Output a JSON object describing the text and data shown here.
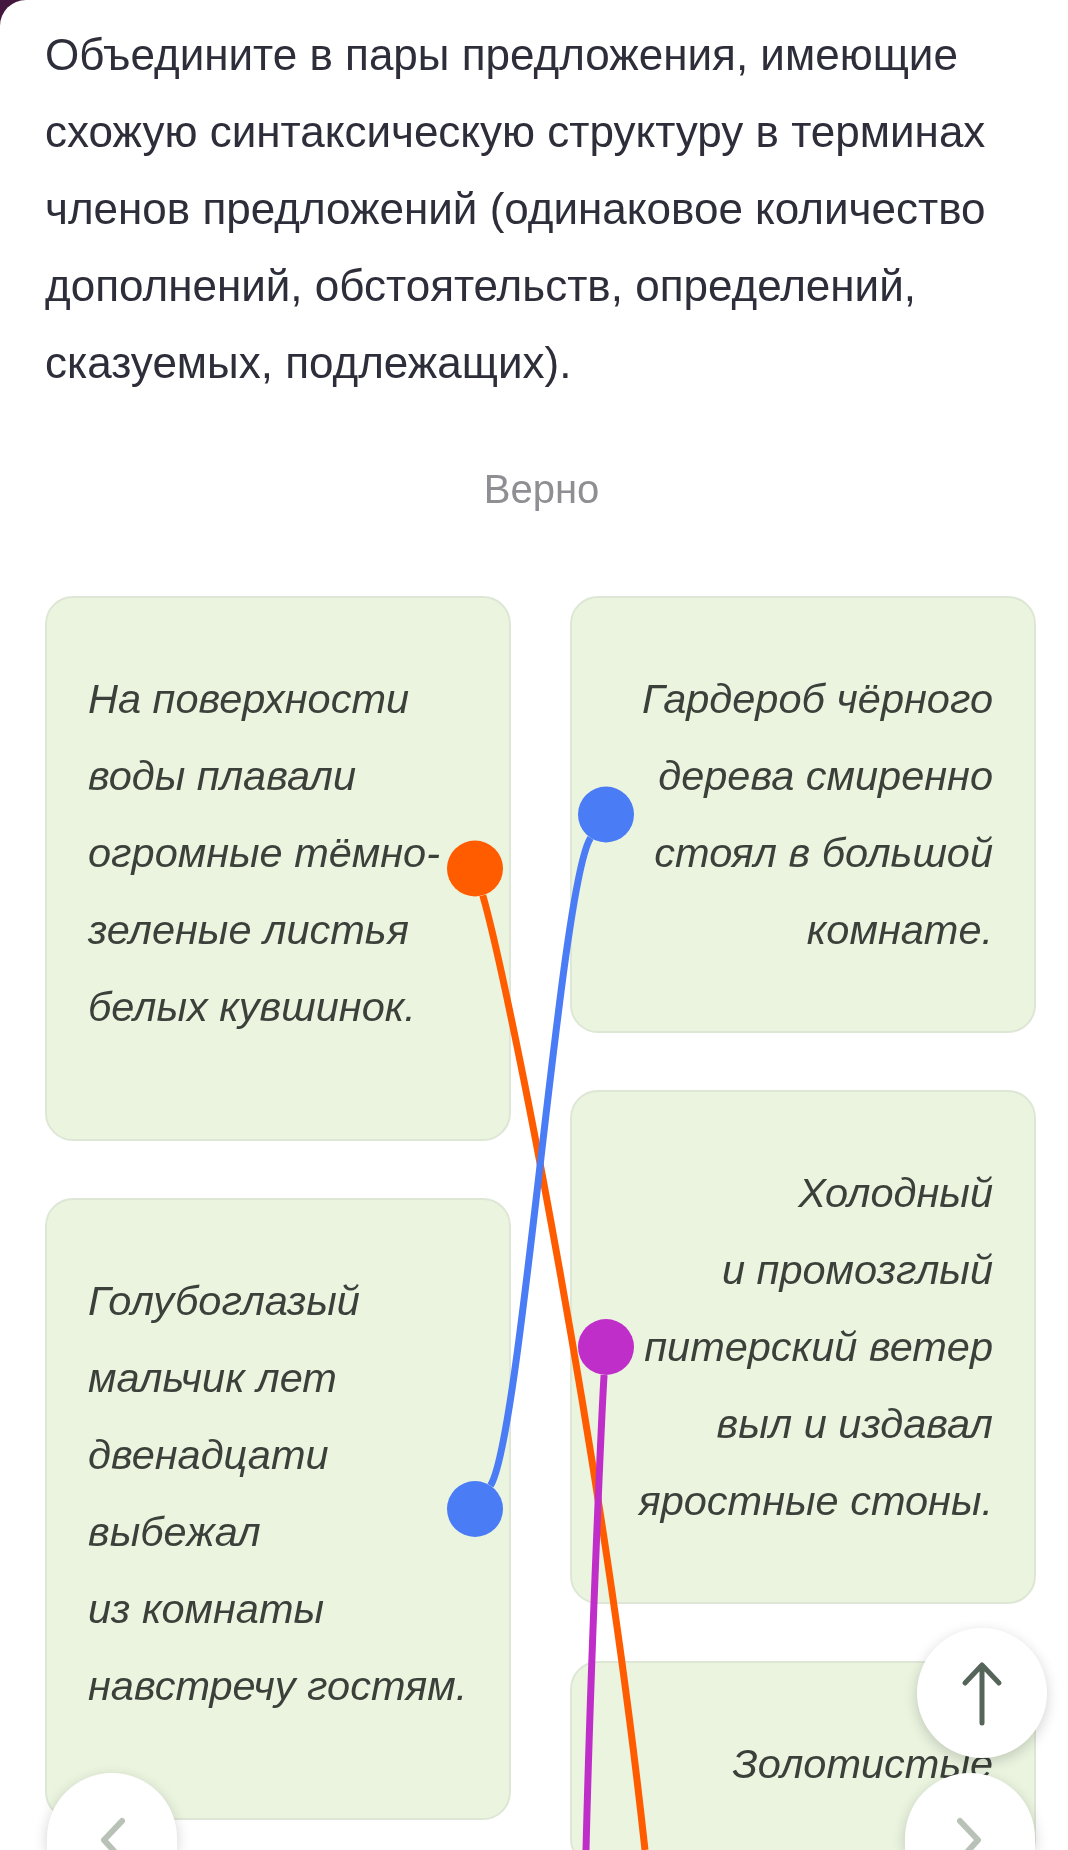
{
  "instruction": "Объедините в пары предложения, имеющие схожую синтаксическую структуру в терминах членов предложений (одинаковое количество дополнений, обстоятельств, определений, сказуемых, подлежащих).",
  "result": "Верно",
  "columns": [
    {
      "cards": [
        {
          "text": "На поверхности воды плавали огромные тёмно-зеленые листья белых кувшинок.",
          "handle": {
            "color": "#ff5c00"
          }
        },
        {
          "text": "Голубоглазый мальчик лет двенадцати выбежал из комнаты навстречу гостям.",
          "handle": {
            "color": "#4a7cf6"
          }
        }
      ]
    },
    {
      "cards": [
        {
          "text": "Гардероб чёрного дерева смиренно стоял в большой комнате.",
          "handle": {
            "color": "#4a7cf6"
          }
        },
        {
          "text": "Холодный и промозглый питерский ветер выл и издавал яростные стоны.",
          "handle": {
            "color": "#c02ec9"
          }
        },
        {
          "text": "Золотистые"
        }
      ]
    }
  ]
}
